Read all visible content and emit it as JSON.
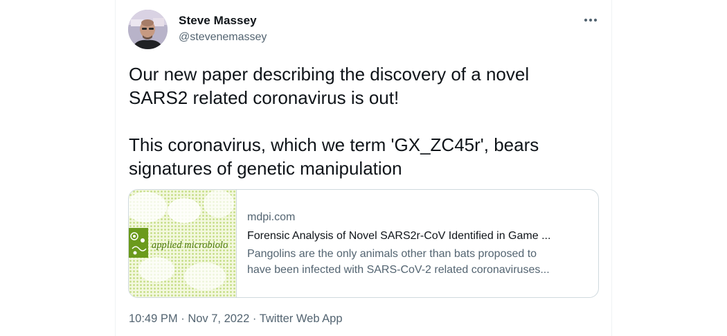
{
  "author": {
    "display_name": "Steve Massey",
    "handle": "@stevenemassey",
    "avatar_icon": "profile-photo"
  },
  "more_icon": "more-horizontal-icon",
  "tweet": {
    "paragraphs": [
      "Our new paper describing the discovery of a novel SARS2 related coronavirus is out!",
      "This coronavirus, which we term 'GX_ZC45r', bears signatures of genetic manipulation"
    ]
  },
  "link_card": {
    "thumbnail_text": "applied microbiolo",
    "domain": "mdpi.com",
    "title": "Forensic Analysis of Novel SARS2r-CoV Identified in Game ...",
    "description_line1": "Pangolins are the only animals other than bats proposed to",
    "description_line2": "have been infected with SARS-CoV-2 related coronaviruses..."
  },
  "meta": {
    "time": "10:49 PM",
    "separator": "·",
    "date": "Nov 7, 2022",
    "source": "Twitter Web App"
  },
  "colors": {
    "text_primary": "#0f1419",
    "text_secondary": "#536471",
    "border": "#cfd9de",
    "thumb_green": "#7aa622"
  }
}
